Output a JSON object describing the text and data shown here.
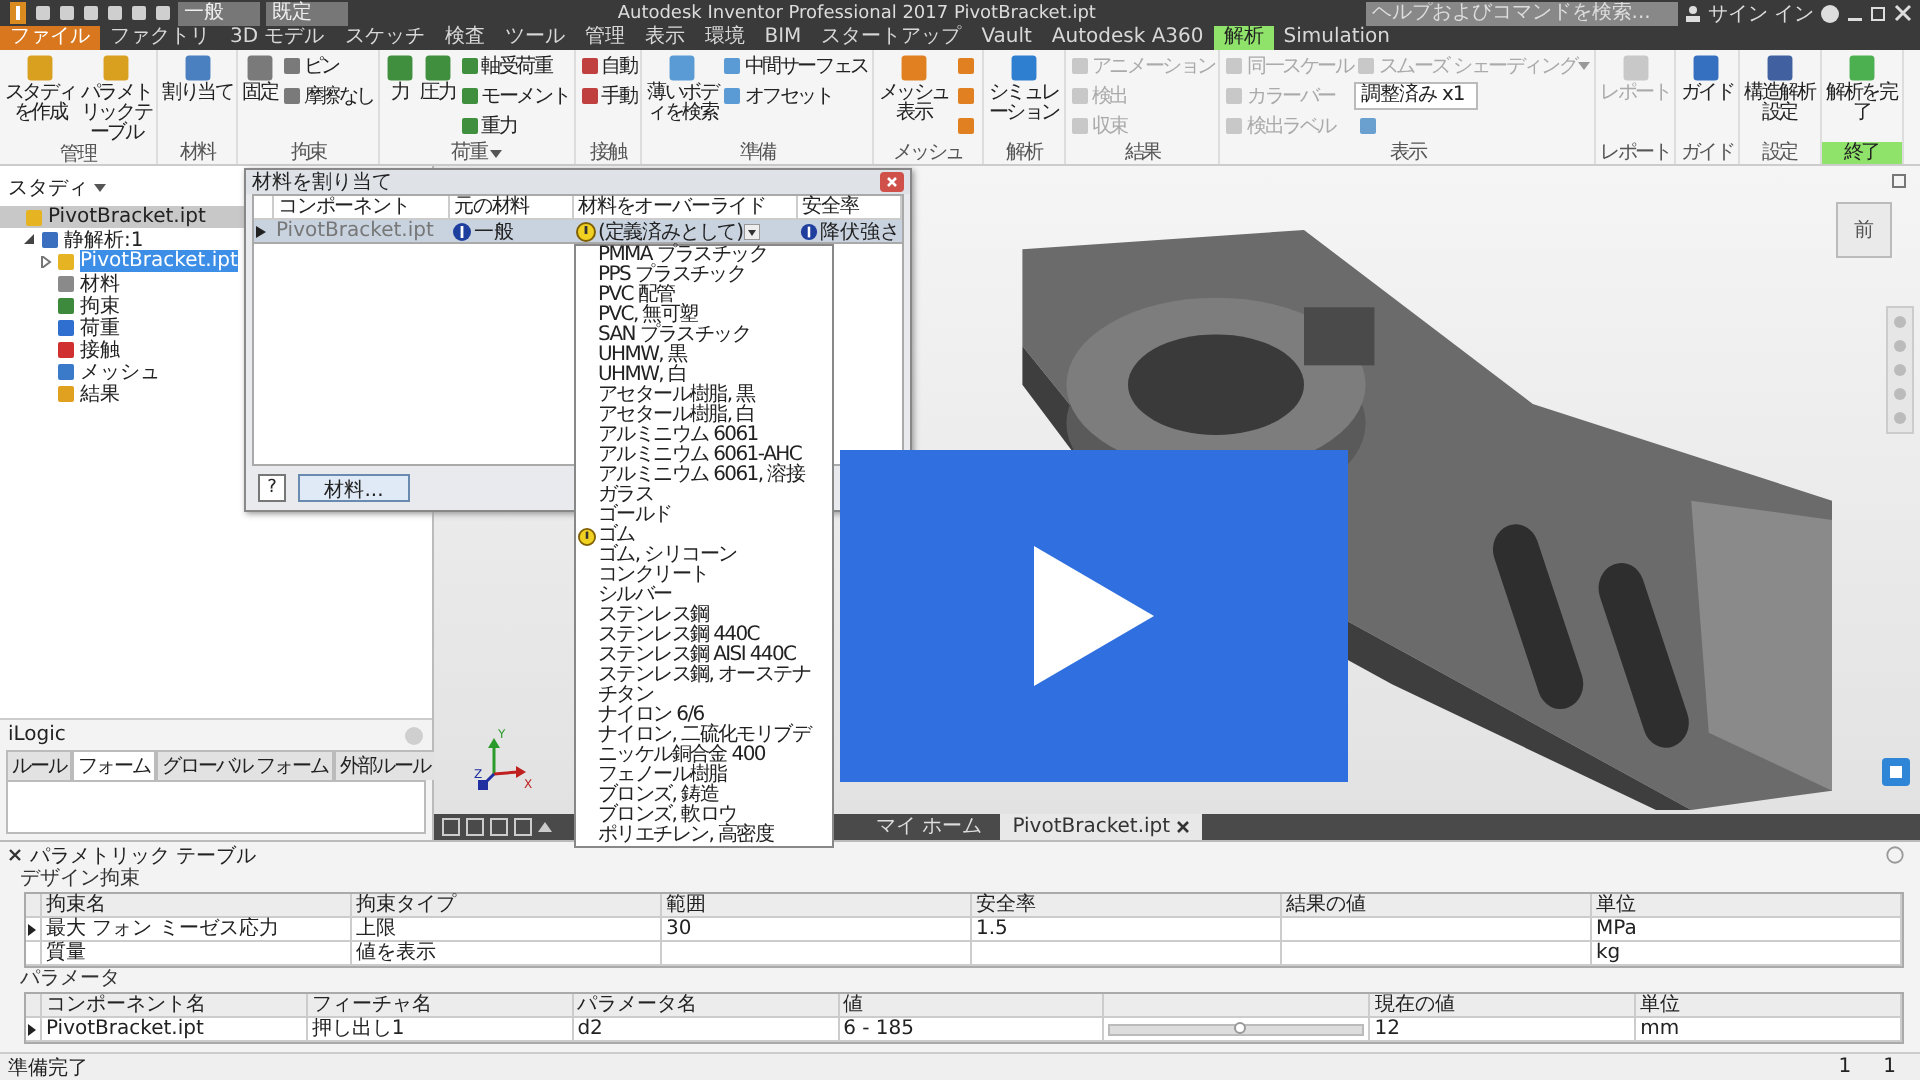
{
  "title_bar": {
    "style_dropdown": "一般",
    "appearance_dropdown": "既定",
    "title": "Autodesk Inventor Professional 2017    PivotBracket.ipt",
    "search": {
      "placeholder": "ヘルプおよびコマンドを検索..."
    },
    "sign_in": "サイン イン"
  },
  "menu_tabs": [
    {
      "label": "ファイル",
      "kind": "file",
      "selected": false
    },
    {
      "label": "ファクトリ",
      "kind": "tab",
      "selected": false
    },
    {
      "label": "3D モデル",
      "kind": "tab",
      "selected": false
    },
    {
      "label": "スケッチ",
      "kind": "tab",
      "selected": false
    },
    {
      "label": "検査",
      "kind": "tab",
      "selected": false
    },
    {
      "label": "ツール",
      "kind": "tab",
      "selected": false
    },
    {
      "label": "管理",
      "kind": "tab",
      "selected": false
    },
    {
      "label": "表示",
      "kind": "tab",
      "selected": false
    },
    {
      "label": "環境",
      "kind": "tab",
      "selected": false
    },
    {
      "label": "BIM",
      "kind": "tab",
      "selected": false
    },
    {
      "label": "スタートアップ",
      "kind": "tab",
      "selected": false
    },
    {
      "label": "Vault",
      "kind": "tab",
      "selected": false
    },
    {
      "label": "Autodesk A360",
      "kind": "tab",
      "selected": false
    },
    {
      "label": "解析",
      "kind": "tab",
      "selected": true
    },
    {
      "label": "Simulation",
      "kind": "tab",
      "selected": false
    }
  ],
  "ribbon": [
    {
      "label": "管理",
      "has_menu": false,
      "highlight": false,
      "buttons": [
        {
          "label": "スタディを作成",
          "kind": "large",
          "disabled": false
        },
        {
          "label": "パラメトリックテーブル",
          "kind": "large",
          "disabled": false
        }
      ]
    },
    {
      "label": "材料",
      "has_menu": false,
      "highlight": false,
      "buttons": [
        {
          "label": "割り当て",
          "kind": "large",
          "disabled": false
        }
      ]
    },
    {
      "label": "拘束",
      "has_menu": false,
      "highlight": false,
      "buttons": [
        {
          "label": "固定",
          "kind": "large",
          "disabled": false
        },
        {
          "label": "ピン",
          "kind": "small",
          "disabled": false
        },
        {
          "label": "摩擦なし",
          "kind": "small",
          "disabled": false
        }
      ]
    },
    {
      "label": "荷重",
      "has_menu": true,
      "highlight": false,
      "buttons": [
        {
          "label": "力",
          "kind": "large",
          "disabled": false
        },
        {
          "label": "圧力",
          "kind": "large",
          "disabled": false
        },
        {
          "label": "軸受荷重",
          "kind": "small",
          "disabled": false
        },
        {
          "label": "モーメント",
          "kind": "small",
          "disabled": false
        },
        {
          "label": "重力",
          "kind": "small",
          "disabled": false
        }
      ]
    },
    {
      "label": "接触",
      "has_menu": false,
      "highlight": false,
      "buttons": [
        {
          "label": "自動",
          "kind": "small",
          "disabled": false
        },
        {
          "label": "手動",
          "kind": "small",
          "disabled": false
        }
      ]
    },
    {
      "label": "準備",
      "has_menu": false,
      "highlight": false,
      "buttons": [
        {
          "label": "薄いボディを検索",
          "kind": "large",
          "disabled": false
        },
        {
          "label": "中間サーフェス",
          "kind": "small",
          "disabled": false
        },
        {
          "label": "オフセット",
          "kind": "small",
          "disabled": false
        }
      ]
    },
    {
      "label": "メッシュ",
      "has_menu": false,
      "highlight": false,
      "buttons": [
        {
          "label": "メッシュ表示",
          "kind": "large",
          "disabled": false
        },
        {
          "kind": "icon",
          "disabled": false
        },
        {
          "kind": "icon",
          "disabled": false
        },
        {
          "kind": "icon",
          "disabled": false
        }
      ]
    },
    {
      "label": "解析",
      "has_menu": false,
      "highlight": false,
      "buttons": [
        {
          "label": "シミュレーション",
          "kind": "large",
          "disabled": false
        }
      ]
    },
    {
      "label": "結果",
      "has_menu": false,
      "highlight": false,
      "buttons": [
        {
          "label": "アニメーション",
          "kind": "small",
          "disabled": true
        },
        {
          "label": "検出",
          "kind": "small",
          "disabled": true
        },
        {
          "label": "収束",
          "kind": "small",
          "disabled": true
        }
      ]
    },
    {
      "label": "表示",
      "has_menu": false,
      "highlight": false,
      "buttons": [
        {
          "label": "同一スケール",
          "kind": "small",
          "disabled": true
        },
        {
          "label": "カラーバー",
          "kind": "small",
          "disabled": true
        },
        {
          "label": "検出ラベル",
          "kind": "small",
          "disabled": true
        },
        {
          "label": "スムーズ シェーディング",
          "kind": "dropdown",
          "disabled": true
        },
        {
          "label": "調整済み x1",
          "kind": "select",
          "disabled": false
        },
        {
          "kind": "icon",
          "disabled": false
        }
      ]
    },
    {
      "label": "レポート",
      "has_menu": false,
      "highlight": false,
      "buttons": [
        {
          "label": "レポート",
          "kind": "large",
          "disabled": true
        }
      ]
    },
    {
      "label": "ガイド",
      "has_menu": false,
      "highlight": false,
      "buttons": [
        {
          "label": "ガイド",
          "kind": "large",
          "disabled": false
        }
      ]
    },
    {
      "label": "設定",
      "has_menu": false,
      "highlight": false,
      "buttons": [
        {
          "label": "構造解析設定",
          "kind": "large",
          "disabled": false
        }
      ]
    },
    {
      "label": "終了",
      "has_menu": false,
      "highlight": true,
      "buttons": [
        {
          "label": "解析を完了",
          "kind": "large",
          "disabled": false
        }
      ]
    }
  ],
  "browser": {
    "title": "スタディ",
    "items": [
      {
        "label": "PivotBracket.ipt",
        "kind": "part",
        "selected": false,
        "active": true,
        "children": [
          {
            "label": "静解析:1",
            "kind": "study",
            "selected": false,
            "active": false,
            "expanded": true,
            "children": [
              {
                "label": "PivotBracket.ipt",
                "kind": "part",
                "selected": true,
                "active": false,
                "expanded": false
              },
              {
                "label": "材料",
                "kind": "material",
                "selected": false,
                "active": false
              },
              {
                "label": "拘束",
                "kind": "constraint",
                "selected": false,
                "active": false
              },
              {
                "label": "荷重",
                "kind": "load",
                "selected": false,
                "active": false
              },
              {
                "label": "接触",
                "kind": "contact",
                "selected": false,
                "active": false
              },
              {
                "label": "メッシュ",
                "kind": "mesh",
                "selected": false,
                "active": false
              },
              {
                "label": "結果",
                "kind": "result",
                "selected": false,
                "active": false
              }
            ]
          }
        ]
      }
    ]
  },
  "ilogic": {
    "title": "iLogic",
    "tabs": [
      {
        "label": "ルール",
        "selected": false
      },
      {
        "label": "フォーム",
        "selected": true
      },
      {
        "label": "グローバル フォーム",
        "selected": false
      },
      {
        "label": "外部ルール",
        "selected": false
      }
    ]
  },
  "dialog": {
    "title": "材料を割り当て",
    "columns": [
      "コンポーネント",
      "元の材料",
      "材料をオーバーライド",
      "安全率"
    ],
    "row": {
      "component": "PivotBracket.ipt",
      "original_material": "一般",
      "override": "(定義済みとして)",
      "safety_factor": "降伏強さ"
    },
    "override_list": [
      {
        "label": "PMMA プラスチック",
        "warning": false
      },
      {
        "label": "PPS プラスチック",
        "warning": false
      },
      {
        "label": "PVC 配管",
        "warning": false
      },
      {
        "label": "PVC, 無可塑",
        "warning": false
      },
      {
        "label": "SAN プラスチック",
        "warning": false
      },
      {
        "label": "UHMW, 黒",
        "warning": false
      },
      {
        "label": "UHMW, 白",
        "warning": false
      },
      {
        "label": "アセタール樹脂, 黒",
        "warning": false
      },
      {
        "label": "アセタール樹脂, 白",
        "warning": false
      },
      {
        "label": "アルミニウム 6061",
        "warning": false
      },
      {
        "label": "アルミニウム 6061-AHC",
        "warning": false
      },
      {
        "label": "アルミニウム 6061, 溶接",
        "warning": false
      },
      {
        "label": "ガラス",
        "warning": false
      },
      {
        "label": "ゴールド",
        "warning": false
      },
      {
        "label": "ゴム",
        "warning": true
      },
      {
        "label": "ゴム, シリコーン",
        "warning": false
      },
      {
        "label": "コンクリート",
        "warning": false
      },
      {
        "label": "シルバー",
        "warning": false
      },
      {
        "label": "ステンレス鋼",
        "warning": false
      },
      {
        "label": "ステンレス鋼 440C",
        "warning": false
      },
      {
        "label": "ステンレス鋼 AISI 440C",
        "warning": false
      },
      {
        "label": "ステンレス鋼, オーステナ",
        "warning": false
      },
      {
        "label": "チタン",
        "warning": false
      },
      {
        "label": "ナイロン 6/6",
        "warning": false
      },
      {
        "label": "ナイロン, 二硫化モリブデ",
        "warning": false
      },
      {
        "label": "ニッケル銅合金 400",
        "warning": false
      },
      {
        "label": "フェノール樹脂",
        "warning": false
      },
      {
        "label": "ブロンズ, 鋳造",
        "warning": false
      },
      {
        "label": "ブロンズ, 軟ロウ",
        "warning": false
      },
      {
        "label": "ポリエチレン, 高密度",
        "warning": false
      }
    ],
    "help_button": "?",
    "materials_button": "材料..."
  },
  "viewport": {
    "view_cube_face": "前",
    "axis_labels": [
      "Y",
      "Z",
      "X"
    ]
  },
  "document_tabs": [
    {
      "label": "マイ ホーム",
      "selected": false,
      "closable": false
    },
    {
      "label": "PivotBracket.ipt",
      "selected": true,
      "closable": true
    }
  ],
  "parametric_table": {
    "title": "パラメトリック テーブル",
    "design_constraints": {
      "label": "デザイン拘束",
      "columns": [
        "拘束名",
        "拘束タイプ",
        "範囲",
        "安全率",
        "結果の値",
        "単位"
      ],
      "rows": [
        {
          "current": true,
          "cells": [
            "最大 フォン ミーゼス応力",
            "上限",
            "30",
            "1.5",
            null,
            "MPa"
          ]
        },
        {
          "current": false,
          "cells": [
            "質量",
            "値を表示",
            null,
            null,
            null,
            "kg"
          ]
        }
      ]
    },
    "parameters": {
      "label": "パラメータ",
      "columns": [
        "コンポーネント名",
        "フィーチャ名",
        "パラメータ名",
        "値",
        null,
        "現在の値",
        "単位"
      ],
      "rows": [
        {
          "current": true,
          "component": "PivotBracket.ipt",
          "feature": "押し出し1",
          "parameter": "d2",
          "value": "6 - 185",
          "level": 0.51,
          "current_value": "12",
          "unit": "mm"
        }
      ]
    }
  },
  "status_bar": {
    "message": "準備完了",
    "counters": [
      "1",
      "1"
    ]
  }
}
